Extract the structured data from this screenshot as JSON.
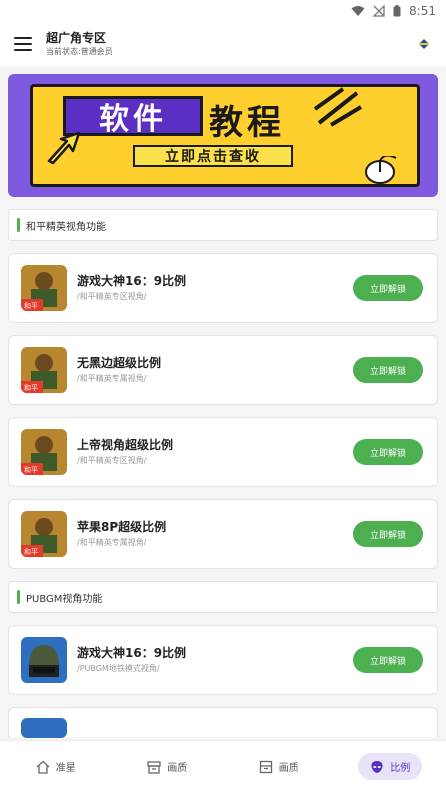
{
  "status_bar": {
    "time": "8:51"
  },
  "app_bar": {
    "title": "超广角专区",
    "subtitle": "当前状态:普通会员"
  },
  "banner": {
    "heading_left": "软件",
    "heading_right": "教程",
    "cta": "立即点击查收"
  },
  "sections": [
    {
      "title": "和平精英视角功能",
      "items": [
        {
          "title": "游戏大神16：9比例",
          "sub": "/和平精英专区视角/",
          "button": "立即解锁",
          "icon": "pubg-mobile-game-icon"
        },
        {
          "title": "无黑边超级比例",
          "sub": "/和平精英专属视角/",
          "button": "立即解锁",
          "icon": "pubg-mobile-game-icon"
        },
        {
          "title": "上帝视角超级比例",
          "sub": "/和平精英专区视角/",
          "button": "立即解锁",
          "icon": "pubg-mobile-game-icon"
        },
        {
          "title": "苹果8P超级比例",
          "sub": "/和平精英专属视角/",
          "button": "立即解锁",
          "icon": "pubg-mobile-game-icon"
        }
      ]
    },
    {
      "title": "PUBGM视角功能",
      "items": [
        {
          "title": "游戏大神16：9比例",
          "sub": "/PUBGM地铁模式视角/",
          "button": "立即解锁",
          "icon": "pubgm-helmet-icon"
        }
      ]
    }
  ],
  "bottom_nav": [
    {
      "label": "准星",
      "icon": "home-icon",
      "active": false
    },
    {
      "label": "画质",
      "icon": "box-icon",
      "active": false
    },
    {
      "label": "画质",
      "icon": "archive-icon",
      "active": false
    },
    {
      "label": "比例",
      "icon": "alien-icon",
      "active": true
    }
  ],
  "colors": {
    "accent_green": "#4caf50",
    "banner_purple": "#7f5ae0",
    "nav_active": "#5b2fc4"
  }
}
